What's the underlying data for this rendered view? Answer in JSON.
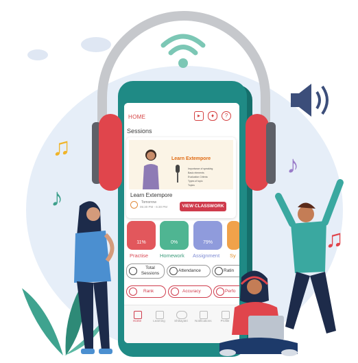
{
  "header": {
    "home_label": "HOME"
  },
  "sessions_label": "Sessions",
  "session_card": {
    "thumbnail_title": "Learn Extempore",
    "thumbnail_bullets": [
      "Importance of speaking",
      "Basic elements",
      "Evaluation Criteria",
      "Types of topic",
      "Topics"
    ],
    "title": "Learn Extempore",
    "day": "Tomorrow",
    "time": "05:30 PM - 6:30 PM",
    "button_label": "VIEW CLASSWORK"
  },
  "tiles": [
    {
      "label": "Practise",
      "value": "11%",
      "color": "#e2575c",
      "label_color": "#d94a55"
    },
    {
      "label": "Homework",
      "value": "0%",
      "color": "#4fb592",
      "label_color": "#3b9a7a"
    },
    {
      "label": "Assignment",
      "value": "79%",
      "color": "#8f9bdc",
      "label_color": "#7d8ad2"
    },
    {
      "label": "Sy",
      "value": "",
      "color": "#f0a24a",
      "label_color": "#e0912c"
    }
  ],
  "pills_row1": [
    "Total Sessions",
    "Attendance",
    "Ratin"
  ],
  "pills_row2": [
    "Rank",
    "Accuracy",
    "Perfo"
  ],
  "tabbar": [
    "Home",
    "Learning",
    "Shikayatri",
    "Notifications",
    "Profile"
  ],
  "colors": {
    "brand_red": "#cf3b4c",
    "phone_teal": "#1f8a85"
  }
}
